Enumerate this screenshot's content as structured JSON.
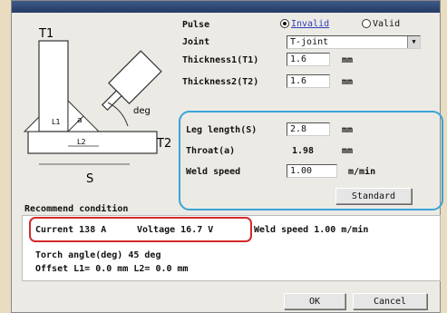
{
  "diagram": {
    "label_t1": "T1",
    "label_t2": "T2",
    "label_s": "S",
    "label_deg": "deg",
    "label_a": "a",
    "label_l1": "L1",
    "label_l2": "L2"
  },
  "pulse": {
    "label": "Pulse",
    "options": [
      "Invalid",
      "Valid"
    ],
    "selected": "Invalid"
  },
  "joint": {
    "label": "Joint",
    "value": "T-joint"
  },
  "thickness1": {
    "label": "Thickness1(T1)",
    "value": "1.6",
    "unit": "mm"
  },
  "thickness2": {
    "label": "Thickness2(T2)",
    "value": "1.6",
    "unit": "mm"
  },
  "leg_length": {
    "label": "Leg length(S)",
    "value": "2.8",
    "unit": "mm"
  },
  "throat": {
    "label": "Throat(a)",
    "value": "1.98",
    "unit": "mm"
  },
  "weld_speed": {
    "label": "Weld speed",
    "value": "1.00",
    "unit": "m/min"
  },
  "standard_button": "Standard",
  "recommend": {
    "title": "Recommend condition",
    "line1_current": "Current 138 A",
    "line1_voltage": "Voltage 16.7 V",
    "line1_speed": "Weld speed   1.00 m/min",
    "line2": "Torch angle(deg)  45 deg",
    "line3": "Offset  L1=  0.0 mm  L2=  0.0 mm"
  },
  "buttons": {
    "ok": "OK",
    "cancel": "Cancel"
  }
}
